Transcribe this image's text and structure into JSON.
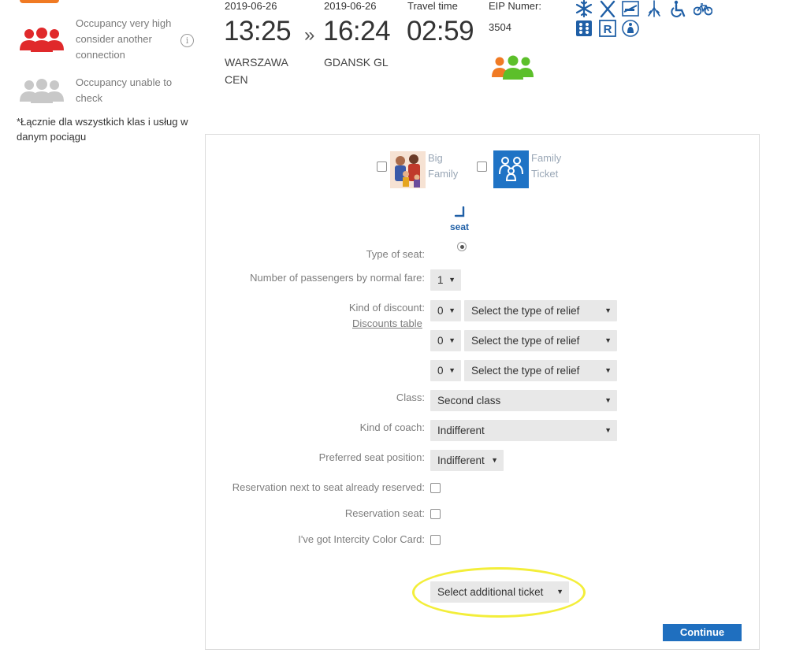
{
  "legend": {
    "very_high_line1": "Occupancy very high",
    "very_high_line2": "consider another",
    "very_high_line3": "connection",
    "unable_line1": "Occupancy unable to",
    "unable_line2": "check",
    "note": "*Łącznie dla wszystkich klas i usług w danym pociągu",
    "colors": {
      "very_high": "#e0292b",
      "unable": "#c8c8c8"
    }
  },
  "train": {
    "dep_date": "2019-06-26",
    "dep_time": "13:25",
    "arrow": "»",
    "arr_date": "2019-06-26",
    "arr_time": "16:24",
    "travel_time_label": "Travel time",
    "travel_time": "02:59",
    "eip_label": "EIP Numer:",
    "eip_number": "3504",
    "from_line1": "WARSZAWA",
    "from_line2": "CEN",
    "to": "GDANSK GL",
    "amenities": [
      "snowflake-icon",
      "restaurant-icon",
      "no-smoking-icon",
      "power-outlet-icon",
      "wheelchair-icon",
      "bicycle-icon",
      "braille-icon",
      "reservation-icon",
      "family-compartment-icon"
    ],
    "occupancy_colors": [
      "#f07a23",
      "#5cbf2a"
    ]
  },
  "tickets": {
    "big_family_line1": "Big",
    "big_family_line2": "Family",
    "family_ticket_line1": "Family",
    "family_ticket_line2": "Ticket",
    "family_ticket_color": "#1f73c5"
  },
  "form": {
    "seat_label": "seat",
    "type_of_seat_label": "Type of seat:",
    "passengers_label": "Number of passengers by normal fare:",
    "passengers_value": "1",
    "discount_label": "Kind of discount:",
    "discounts_table_link": "Discounts table",
    "discounts": [
      {
        "count": "0",
        "type": "Select the type of relief"
      },
      {
        "count": "0",
        "type": "Select the type of relief"
      },
      {
        "count": "0",
        "type": "Select the type of relief"
      }
    ],
    "class_label": "Class:",
    "class_value": "Second class",
    "coach_label": "Kind of coach:",
    "coach_value": "Indifferent",
    "seat_position_label": "Preferred seat position:",
    "seat_position_value": "Indifferent",
    "next_to_reserved_label": "Reservation next to seat already reserved:",
    "reservation_seat_label": "Reservation seat:",
    "color_card_label": "I've got Intercity Color Card:",
    "additional_ticket_value": "Select additional ticket",
    "continue_label": "Continue",
    "caret": "▼"
  }
}
